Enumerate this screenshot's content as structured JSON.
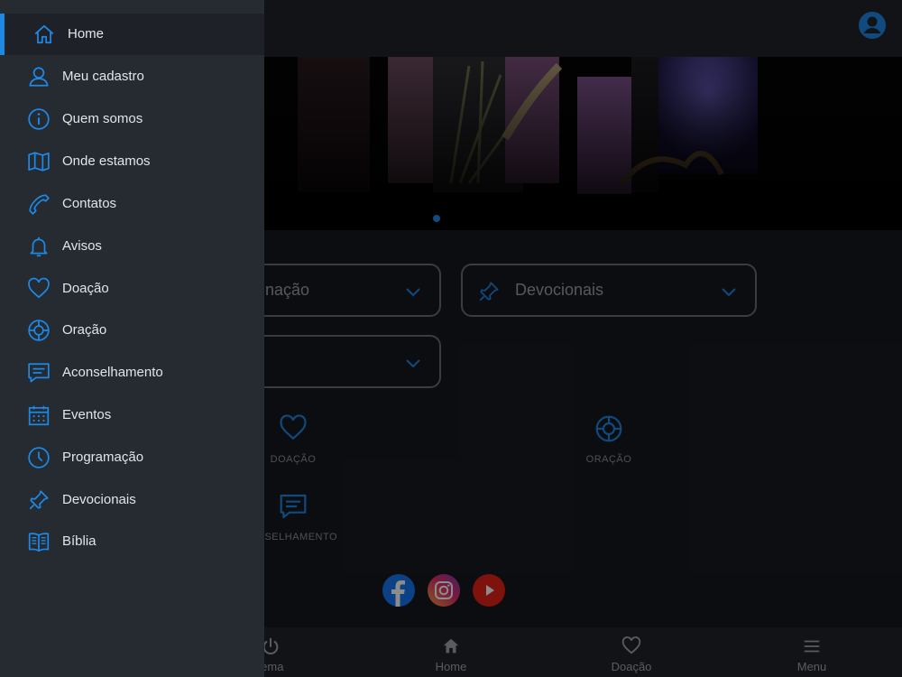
{
  "colors": {
    "accent": "#1e88e5",
    "drawer_bg": "#262a31",
    "page_bg": "#17191f",
    "facebook": "#1877f2",
    "youtube": "#e62117"
  },
  "menu": {
    "items": [
      {
        "label": "Home",
        "icon": "home-icon",
        "active": true
      },
      {
        "label": "Meu cadastro",
        "icon": "user-icon"
      },
      {
        "label": "Quem somos",
        "icon": "info-icon"
      },
      {
        "label": "Onde estamos",
        "icon": "map-icon"
      },
      {
        "label": "Contatos",
        "icon": "phone-icon"
      },
      {
        "label": "Avisos",
        "icon": "bell-icon"
      },
      {
        "label": "Doação",
        "icon": "heart-icon"
      },
      {
        "label": "Oração",
        "icon": "lifebuoy-icon"
      },
      {
        "label": "Aconselhamento",
        "icon": "chat-icon"
      },
      {
        "label": "Eventos",
        "icon": "calendar-icon"
      },
      {
        "label": "Programação",
        "icon": "clock-icon"
      },
      {
        "label": "Devocionais",
        "icon": "pin-icon"
      },
      {
        "label": "Bíblia",
        "icon": "book-icon"
      }
    ]
  },
  "main": {
    "dropdowns": [
      {
        "label": "nação"
      },
      {
        "label": "Devocionais",
        "icon": "pin-icon"
      },
      {
        "label": ""
      }
    ],
    "grid": [
      {
        "label": "DOAÇÃO",
        "icon": "heart-icon"
      },
      {
        "label": "ORAÇÃO",
        "icon": "lifebuoy-icon"
      },
      {
        "label": "ONSELHAMENTO",
        "icon": "chat-icon"
      }
    ],
    "social": [
      "facebook-icon",
      "instagram-icon",
      "youtube-icon"
    ]
  },
  "bottom_nav": [
    {
      "label": "tema",
      "icon": "power-icon"
    },
    {
      "label": "Home",
      "icon": "home-icon"
    },
    {
      "label": "Doação",
      "icon": "heart-icon"
    },
    {
      "label": "Menu",
      "icon": "menu-icon"
    }
  ]
}
